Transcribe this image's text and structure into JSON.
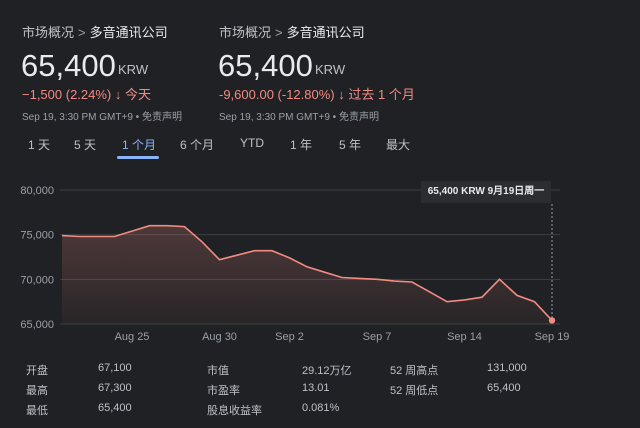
{
  "cards": [
    {
      "breadcrumb": "市场概况",
      "company": "多音通讯公司",
      "price": "65,400",
      "currency": "KRW",
      "change": "−1,500 (2.24%)",
      "period": "今天",
      "meta": "Sep 19, 3:30 PM GMT+9 • 免责声明"
    },
    {
      "breadcrumb": "市场概况",
      "company": "多音通讯公司",
      "price": "65,400",
      "currency": "KRW",
      "change": "-9,600.00 (-12.80%)",
      "period": "过去 1 个月",
      "meta": "Sep 19, 3:30 PM GMT+9 • 免责声明"
    }
  ],
  "tabs": [
    "1 天",
    "5 天",
    "1 个月",
    "6 个月",
    "YTD",
    "1 年",
    "5 年",
    "最大"
  ],
  "active_tab": "1 个月",
  "tooltip": "65,400 KRW   9月19日周一",
  "colors": {
    "line": "#f28b82",
    "accent": "#8ab4f8",
    "background": "#202124"
  },
  "chart_data": {
    "type": "area",
    "ylim": [
      65000,
      80000
    ],
    "yticks": [
      "80,000",
      "75,000",
      "70,000",
      "65,000"
    ],
    "ytick_values": [
      80000,
      75000,
      70000,
      65000
    ],
    "xticks": [
      "Aug 25",
      "Aug 30",
      "Sep 2",
      "Sep 7",
      "Sep 14",
      "Sep 19"
    ],
    "xtick_index": [
      4,
      9,
      13,
      18,
      23,
      28
    ],
    "series": [
      {
        "values": [
          74900,
          74800,
          74800,
          74800,
          75400,
          76000,
          76000,
          75900,
          74200,
          72200,
          72700,
          73200,
          73200,
          72400,
          71400,
          70800,
          70200,
          70100,
          70000,
          69800,
          69700,
          68600,
          67500,
          67700,
          68000,
          70000,
          68200,
          67500,
          65400
        ]
      }
    ],
    "xlabel": "",
    "ylabel": "",
    "grid": true
  },
  "stats": [
    {
      "label": "开盘",
      "value": "67,100"
    },
    {
      "label": "最高",
      "value": "67,300"
    },
    {
      "label": "最低",
      "value": "65,400"
    },
    {
      "label": "市值",
      "value": "29.12万亿"
    },
    {
      "label": "市盈率",
      "value": "13.01"
    },
    {
      "label": "股息收益率",
      "value": "0.081%"
    },
    {
      "label": "52 周高点",
      "value": "131,000"
    },
    {
      "label": "52 周低点",
      "value": "65,400"
    }
  ]
}
